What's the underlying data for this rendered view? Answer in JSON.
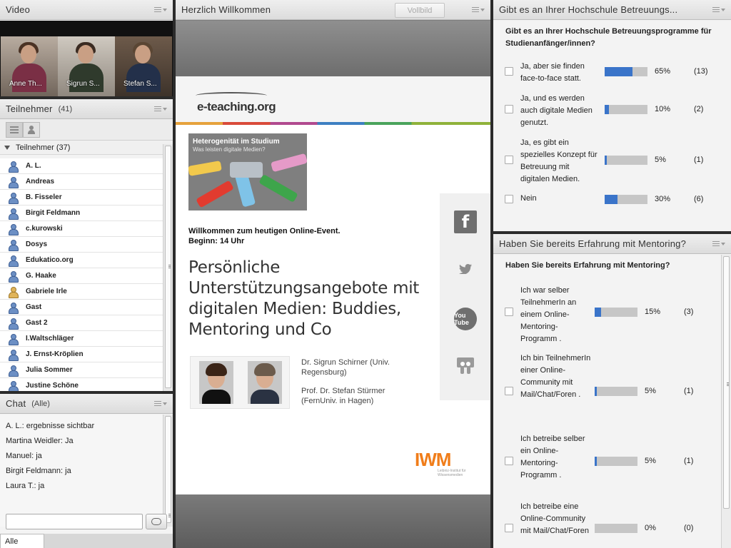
{
  "video": {
    "title": "Video",
    "tiles": [
      {
        "name": "Anne Th..."
      },
      {
        "name": "Sigrun S..."
      },
      {
        "name": "Stefan S..."
      }
    ]
  },
  "participants": {
    "title": "Teilnehmer",
    "count": "(41)",
    "group_label": "Teilnehmer (37)",
    "list": [
      "A. L.",
      "Andreas",
      "B. Fisseler",
      "Birgit Feldmann",
      "c.kurowski",
      "Dosys",
      "Edukatico.org",
      "G. Haake",
      "Gabriele Irle",
      "Gast",
      "Gast 2",
      "I.Waltschläger",
      "J. Ernst-Kröplien",
      "Julia Sommer",
      "Justine Schöne"
    ]
  },
  "chat": {
    "title": "Chat",
    "scope": "(Alle)",
    "messages": [
      {
        "who": "A. L.:",
        "text": "ergebnisse sichtbar"
      },
      {
        "who": "Martina Weidler:",
        "text": "Ja"
      },
      {
        "who": "Manuel:",
        "text": "ja"
      },
      {
        "who": "Birgit Feldmann:",
        "text": "ja"
      },
      {
        "who": "Laura T.:",
        "text": "ja"
      }
    ],
    "tab_label": "Alle"
  },
  "share": {
    "title": "Herzlich Willkommen",
    "fullscreen_label": "Vollbild",
    "slide": {
      "logo": "e-teaching.org",
      "hero_title": "Heterogenität im Studium",
      "hero_sub": "Was leisten digitale Medien?",
      "welcome_1": "Willkommen zum heutigen Online-Event.",
      "welcome_2": "Beginn: 14 Uhr",
      "title": "Persönliche Unterstützungsangebote mit digitalen Medien: Buddies, Mentoring und Co",
      "speaker1_line1": "Dr. Sigrun Schirner (Univ.",
      "speaker1_line2": "Regensburg)",
      "speaker2_line1": "Prof. Dr. Stefan Stürmer",
      "speaker2_line2": "(FernUniv. in Hagen)",
      "iwm": "IWM",
      "iwm_sub": "Leibniz-Institut für Wissensmedien",
      "youtube": "You Tube"
    }
  },
  "poll1": {
    "title": "Gibt es an Ihrer Hochschule Betreuungs...",
    "question": "Gibt es an Ihrer Hochschule Betreuungsprogramme für Studienanfänger/innen?",
    "options": [
      {
        "text": "Ja, aber sie finden face-to-face statt.",
        "percent": 65,
        "pct_label": "65%",
        "count": "(13)"
      },
      {
        "text": "Ja, und es werden auch digitale Medien genutzt.",
        "percent": 10,
        "pct_label": "10%",
        "count": "(2)"
      },
      {
        "text": "Ja, es gibt ein spezielles Konzept für Betreuung mit digitalen Medien.",
        "percent": 5,
        "pct_label": "5%",
        "count": "(1)"
      },
      {
        "text": "Nein",
        "percent": 30,
        "pct_label": "30%",
        "count": "(6)"
      }
    ]
  },
  "poll2": {
    "title": "Haben Sie bereits Erfahrung mit Mentoring?",
    "question": "Haben Sie bereits Erfahrung mit Mentoring?",
    "options": [
      {
        "text": "Ich war selber TeilnehmerIn an einem Online-Mentoring-Programm .",
        "percent": 15,
        "pct_label": "15%",
        "count": "(3)"
      },
      {
        "text": "Ich bin TeilnehmerIn einer Online-Community mit Mail/Chat/Foren .",
        "percent": 5,
        "pct_label": "5%",
        "count": "(1)"
      },
      {
        "text": "Ich betreibe selber ein Online-Mentoring-Programm .",
        "percent": 5,
        "pct_label": "5%",
        "count": "(1)"
      },
      {
        "text": "Ich betreibe eine Online-Community mit Mail/Chat/Foren",
        "percent": 0,
        "pct_label": "0%",
        "count": "(0)"
      }
    ]
  },
  "colors": {
    "bar_fill": "#3a74c9",
    "bar_bg": "#c6c6c6",
    "iwm_orange": "#f07d1a"
  }
}
